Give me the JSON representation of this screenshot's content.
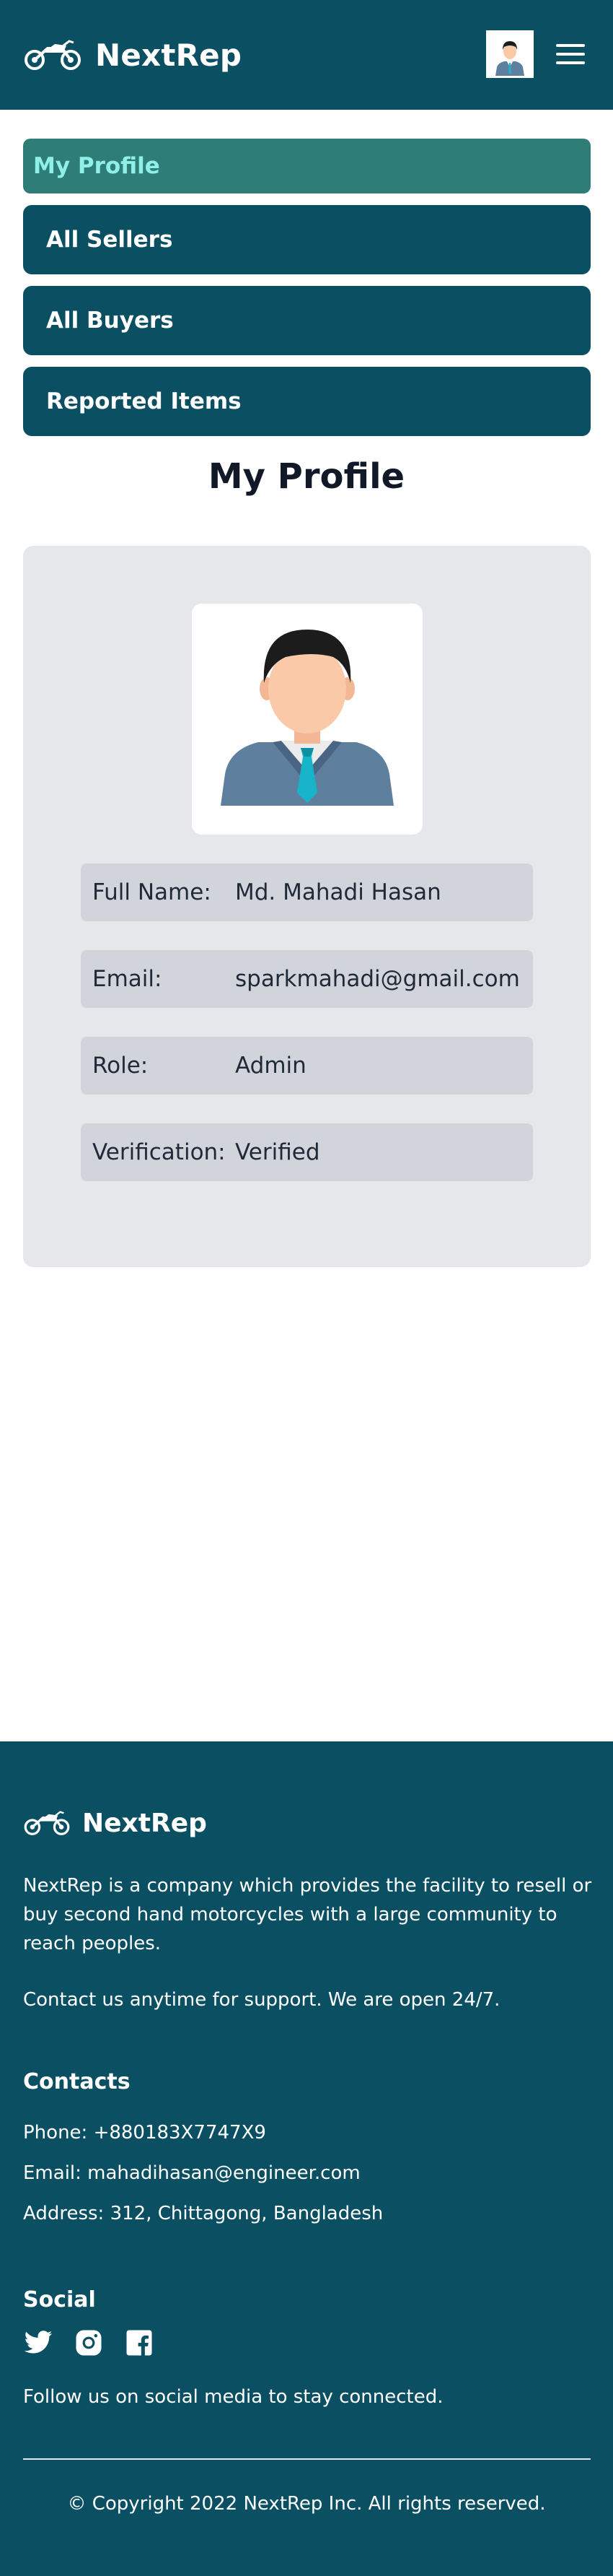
{
  "header": {
    "brand": "NextRep",
    "brand_icon": "motorcycle-icon",
    "avatar_icon": "user-avatar-icon",
    "menu_icon": "hamburger-icon"
  },
  "nav": {
    "items": [
      {
        "label": "My Profile",
        "active": true
      },
      {
        "label": "All Sellers",
        "active": false
      },
      {
        "label": "All Buyers",
        "active": false
      },
      {
        "label": "Reported Items",
        "active": false
      }
    ]
  },
  "main": {
    "title": "My Profile",
    "profile": {
      "photo_icon": "businessman-avatar-icon",
      "fields": [
        {
          "label": "Full Name:",
          "value": "Md. Mahadi Hasan"
        },
        {
          "label": "Email:",
          "value": "sparkmahadi@gmail.com"
        },
        {
          "label": "Role:",
          "value": "Admin"
        },
        {
          "label": "Verification:",
          "value": "Verified"
        }
      ]
    }
  },
  "footer": {
    "brand": "NextRep",
    "about": "NextRep is a company which provides the facility to resell or buy second hand motorcycles with a large community to reach peoples.",
    "support": "Contact us anytime for support. We are open 24/7.",
    "contacts_heading": "Contacts",
    "contacts": [
      "Phone: +880183X7747X9",
      "Email: mahadihasan@engineer.com",
      "Address: 312, Chittagong, Bangladesh"
    ],
    "social_heading": "Social",
    "social_icons": [
      "twitter-icon",
      "instagram-icon",
      "facebook-icon"
    ],
    "follow_text": "Follow us on social media to stay connected.",
    "copyright": "© Copyright 2022 NextRep Inc. All rights reserved."
  },
  "colors": {
    "primary": "#0b4f63",
    "active_nav_bg": "#2e7d76",
    "active_nav_text": "#8ff0ea",
    "card_bg": "#e5e7eb",
    "field_bg": "#d1d5db"
  }
}
